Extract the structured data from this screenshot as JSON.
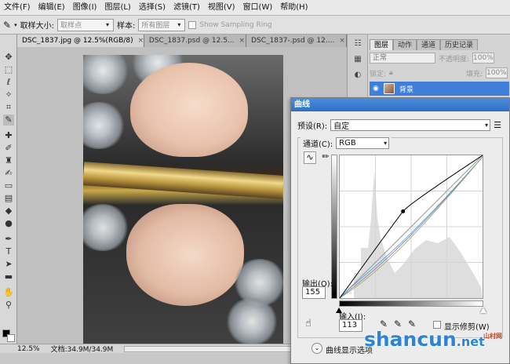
{
  "menubar": {
    "items": [
      "文件(F)",
      "编辑(E)",
      "图像(I)",
      "图层(L)",
      "选择(S)",
      "滤镜(T)",
      "视图(V)",
      "窗口(W)",
      "帮助(H)"
    ]
  },
  "options_bar": {
    "tool_icon": "eyedropper-icon",
    "sample_size_label": "取样大小:",
    "sample_size_value": "取样点",
    "sample_label": "样本:",
    "sample_value": "所有图层",
    "show_sampling_ring_label": "Show Sampling Ring"
  },
  "document_tabs": [
    {
      "label": "DSC_1837.jpg @ 12.5%(RGB/8)",
      "active": true
    },
    {
      "label": "DSC_1837.psd @ 12.5...",
      "active": false
    },
    {
      "label": "DSC_1837-.psd @ 12....",
      "active": false
    }
  ],
  "tools": [
    "move-icon",
    "marquee-icon",
    "lasso-icon",
    "quick-select-icon",
    "crop-icon",
    "eyedropper-icon",
    "healing-icon",
    "brush-icon",
    "clone-stamp-icon",
    "history-brush-icon",
    "eraser-icon",
    "gradient-icon",
    "blur-icon",
    "dodge-icon",
    "pen-icon",
    "type-icon",
    "path-select-icon",
    "shape-icon",
    "hand-icon",
    "zoom-icon"
  ],
  "status_bar": {
    "zoom": "12.5%",
    "doc_label": "文档:34.9M/34.9M"
  },
  "layers_panel": {
    "tabs": [
      "图层",
      "动作",
      "通道",
      "历史记录"
    ],
    "blend_mode": "正常",
    "opacity_label": "不透明度:",
    "opacity_value": "100%",
    "lock_label": "锁定:",
    "fill_label": "填充:",
    "fill_value": "100%",
    "layer_name": "背景"
  },
  "curves_dialog": {
    "title": "曲线",
    "preset_label": "预设(R):",
    "preset_value": "自定",
    "channel_label": "通道(C):",
    "channel_value": "RGB",
    "output_label": "输出(O):",
    "output_value": "155",
    "input_label": "输入(I):",
    "input_value": "113",
    "show_clipping_label": "显示修剪(W)",
    "display_options_label": "曲线显示选项",
    "curve_control_point": {
      "input": 113,
      "output": 155
    }
  },
  "watermark": {
    "text_main": "shancun",
    "text_domain": ".net",
    "text_sub": "山村网"
  },
  "colors": {
    "titlebar_blue": "#2f6fc5",
    "layer_selected": "#3f7fd9",
    "watermark_blue": "#2c84d3"
  }
}
